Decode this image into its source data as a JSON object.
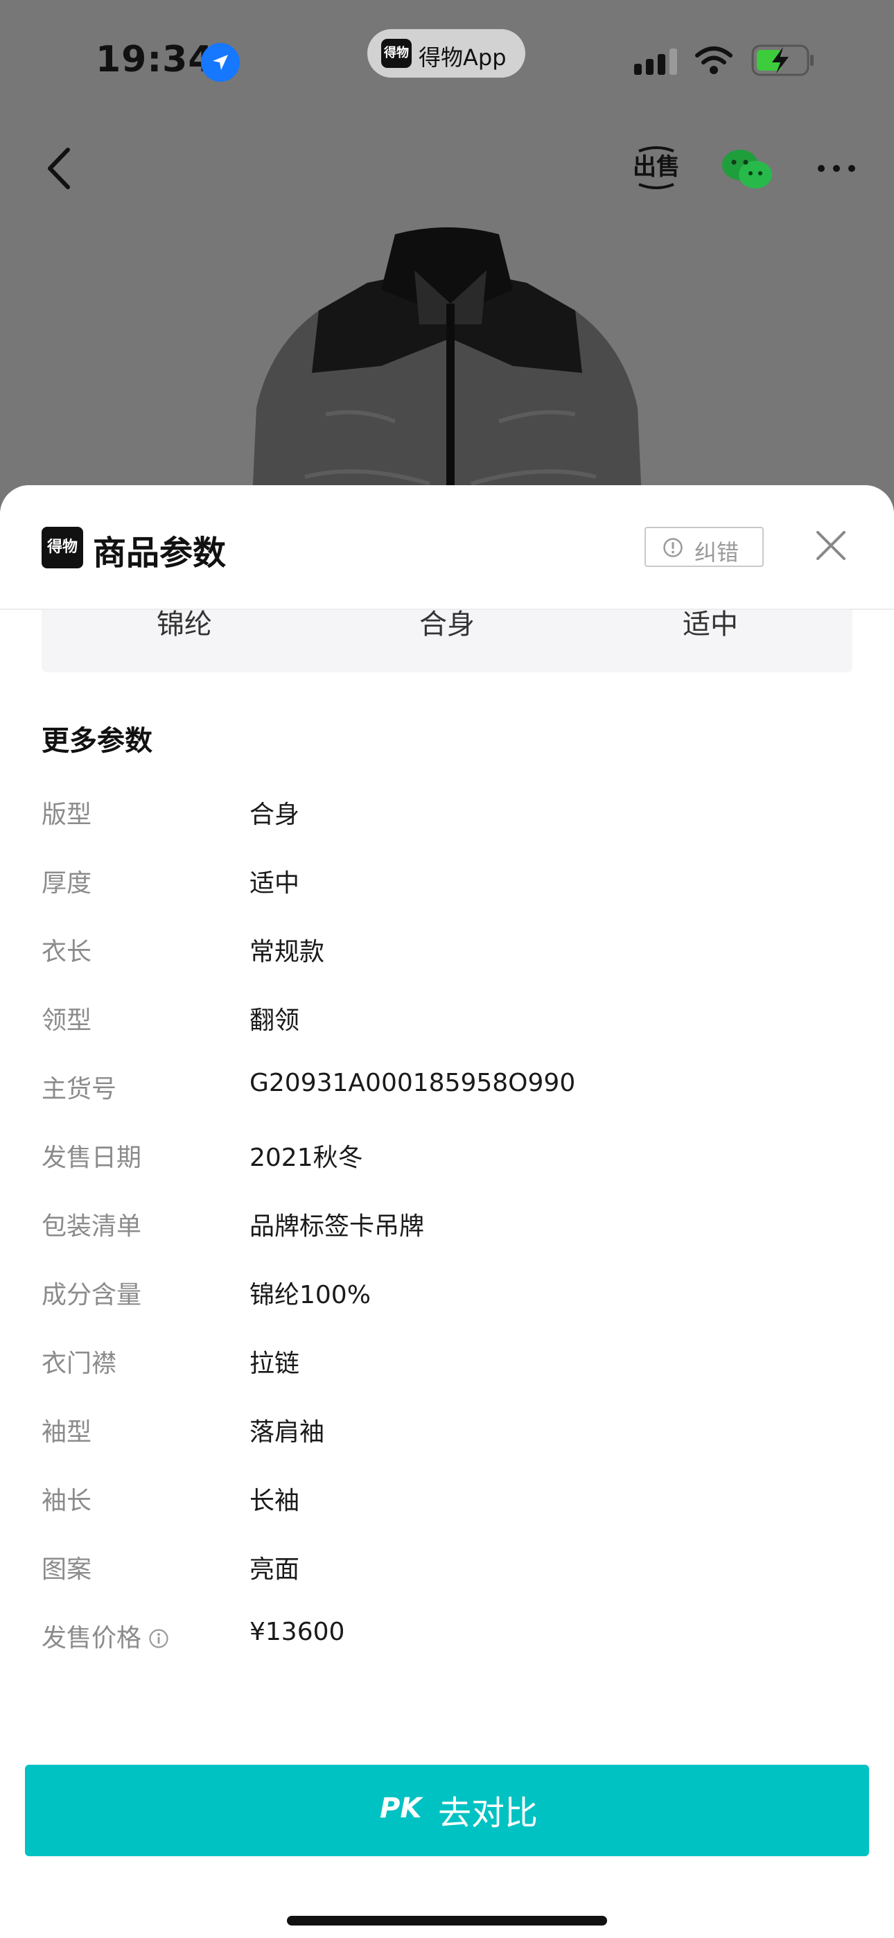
{
  "status_bar": {
    "time": "19:34",
    "app_pill_logo": "得物",
    "app_pill_name": "得物App",
    "icons": [
      "location-arrow-icon",
      "cellular-signal-icon",
      "wifi-icon",
      "battery-charging-icon"
    ]
  },
  "nav": {
    "icons": [
      "back-chevron-icon",
      "sell-icon",
      "wechat-share-icon",
      "more-dots-icon"
    ]
  },
  "sheet": {
    "logo_text": "得物",
    "title": "商品参数",
    "report_label": "纠错",
    "cut_row": [
      "锦纶",
      "合身",
      "适中"
    ],
    "section_title": "更多参数",
    "params": [
      {
        "label": "版型",
        "value": "合身"
      },
      {
        "label": "厚度",
        "value": "适中"
      },
      {
        "label": "衣长",
        "value": "常规款"
      },
      {
        "label": "领型",
        "value": "翻领"
      },
      {
        "label": "主货号",
        "value": "G20931A000185958O990"
      },
      {
        "label": "发售日期",
        "value": "2021秋冬"
      },
      {
        "label": "包装清单",
        "value": "品牌标签卡吊牌"
      },
      {
        "label": "成分含量",
        "value": "锦纶100%"
      },
      {
        "label": "衣门襟",
        "value": "拉链"
      },
      {
        "label": "袖型",
        "value": "落肩袖"
      },
      {
        "label": "袖长",
        "value": "长袖"
      },
      {
        "label": "图案",
        "value": "亮面"
      },
      {
        "label": "发售价格",
        "value": "¥13600"
      }
    ],
    "pk_badge": "PK",
    "pk_label": "去对比"
  },
  "colors": {
    "accent": "#01c2c3",
    "backdrop": "#777777",
    "label_gray": "#8b8b8b"
  }
}
